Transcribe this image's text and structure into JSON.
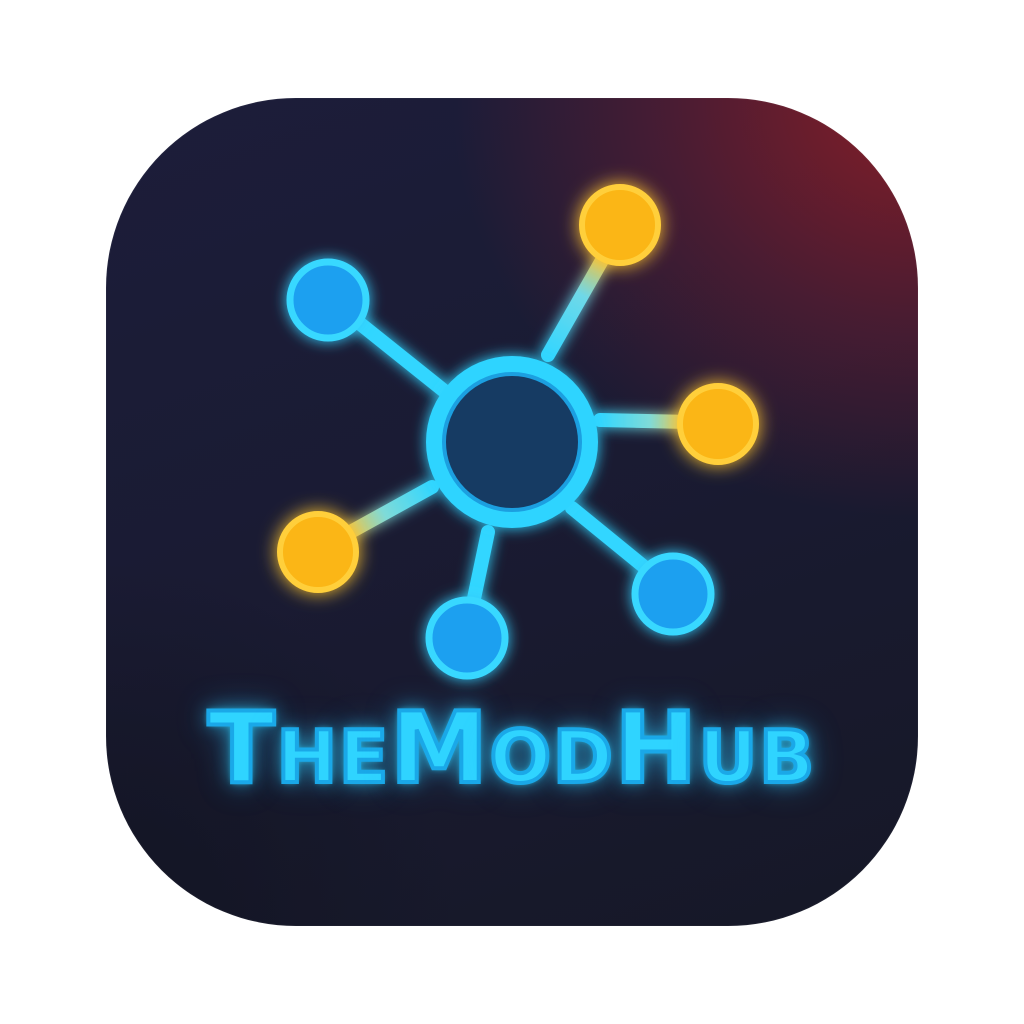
{
  "logo": {
    "brand_text": "TheModHub",
    "brand_parts": [
      {
        "text": "T",
        "style": "cap"
      },
      {
        "text": "HE",
        "style": "small"
      },
      {
        "text": "M",
        "style": "cap"
      },
      {
        "text": "OD",
        "style": "small"
      },
      {
        "text": "H",
        "style": "cap"
      },
      {
        "text": "UB",
        "style": "small"
      }
    ],
    "icon_name": "network-hub-icon",
    "colors": {
      "glow_cyan": "#2fd4ff",
      "node_blue": "#1ea0f0",
      "node_yellow": "#fbb614",
      "hub_fill": "#163a63",
      "bg_dark": "#181a2e",
      "bg_red": "#8c1e26"
    }
  }
}
